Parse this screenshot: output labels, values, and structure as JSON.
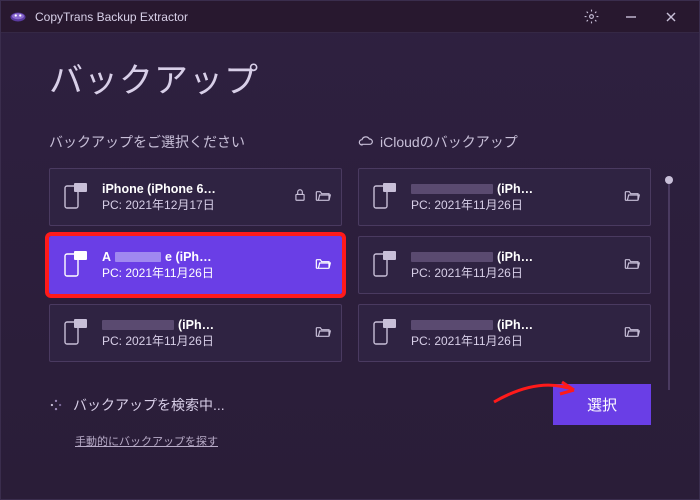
{
  "titlebar": {
    "app_name": "CopyTrans Backup Extractor"
  },
  "page": {
    "title": "バックアップ"
  },
  "columns": {
    "local": {
      "header": "バックアップをご選択ください"
    },
    "icloud": {
      "header": "iCloudのバックアップ"
    }
  },
  "backups": {
    "local": [
      {
        "name": "iPhone (iPhone 6…",
        "sub": "PC: 2021年12月17日",
        "locked": true
      },
      {
        "name_prefix": "A",
        "name_suffix": "e (iPh…",
        "sub": "PC: 2021年11月26日",
        "selected": true
      },
      {
        "name_suffix": "(iPh…",
        "sub": "PC: 2021年11月26日"
      }
    ],
    "icloud": [
      {
        "name_suffix": "(iPh…",
        "sub": "PC: 2021年11月26日"
      },
      {
        "name_suffix": "(iPh…",
        "sub": "PC: 2021年11月26日"
      },
      {
        "name_suffix": "(iPh…",
        "sub": "PC: 2021年11月26日"
      }
    ]
  },
  "footer": {
    "searching": "バックアップを検索中...",
    "manual_link": "手動的にバックアップを探す",
    "select_button": "選択"
  }
}
